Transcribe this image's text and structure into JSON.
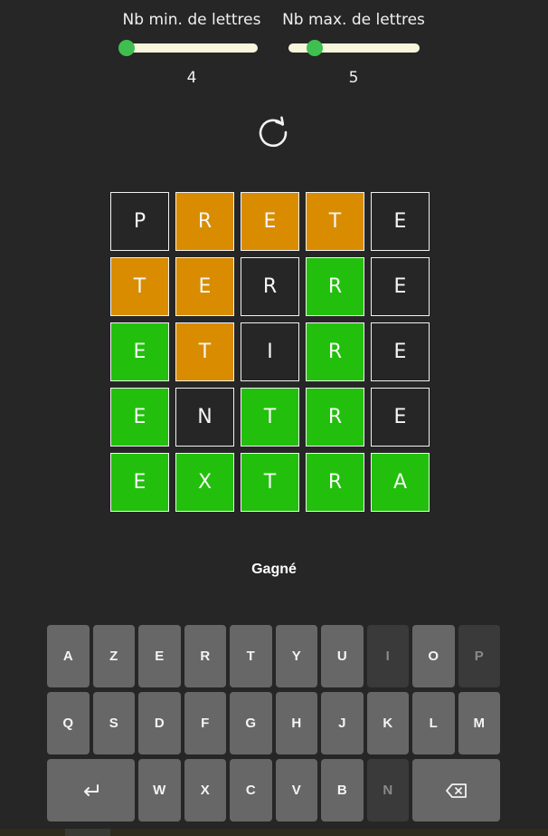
{
  "sliders": {
    "min": {
      "label": "Nb min. de lettres",
      "value": "4",
      "fraction": 0.0
    },
    "max": {
      "label": "Nb max. de lettres",
      "value": "5",
      "fraction": 0.2
    }
  },
  "colors": {
    "absent": "#262626",
    "present": "#d98c00",
    "correct": "#22c00c",
    "slider_thumb": "#3fbf4f",
    "slider_track": "#f7f5dc"
  },
  "reset_icon": "refresh-icon",
  "grid": [
    [
      {
        "letter": "P",
        "state": "absent"
      },
      {
        "letter": "R",
        "state": "present"
      },
      {
        "letter": "E",
        "state": "present"
      },
      {
        "letter": "T",
        "state": "present"
      },
      {
        "letter": "E",
        "state": "absent"
      }
    ],
    [
      {
        "letter": "T",
        "state": "present"
      },
      {
        "letter": "E",
        "state": "present"
      },
      {
        "letter": "R",
        "state": "absent"
      },
      {
        "letter": "R",
        "state": "correct"
      },
      {
        "letter": "E",
        "state": "absent"
      }
    ],
    [
      {
        "letter": "E",
        "state": "correct"
      },
      {
        "letter": "T",
        "state": "present"
      },
      {
        "letter": "I",
        "state": "absent"
      },
      {
        "letter": "R",
        "state": "correct"
      },
      {
        "letter": "E",
        "state": "absent"
      }
    ],
    [
      {
        "letter": "E",
        "state": "correct"
      },
      {
        "letter": "N",
        "state": "absent"
      },
      {
        "letter": "T",
        "state": "correct"
      },
      {
        "letter": "R",
        "state": "correct"
      },
      {
        "letter": "E",
        "state": "absent"
      }
    ],
    [
      {
        "letter": "E",
        "state": "correct"
      },
      {
        "letter": "X",
        "state": "correct"
      },
      {
        "letter": "T",
        "state": "correct"
      },
      {
        "letter": "R",
        "state": "correct"
      },
      {
        "letter": "A",
        "state": "correct"
      }
    ]
  ],
  "status": "Gagné",
  "keyboard": [
    [
      {
        "label": "A",
        "used": false
      },
      {
        "label": "Z",
        "used": false
      },
      {
        "label": "E",
        "used": false
      },
      {
        "label": "R",
        "used": false
      },
      {
        "label": "T",
        "used": false
      },
      {
        "label": "Y",
        "used": false
      },
      {
        "label": "U",
        "used": false
      },
      {
        "label": "I",
        "used": true
      },
      {
        "label": "O",
        "used": false
      },
      {
        "label": "P",
        "used": true
      }
    ],
    [
      {
        "label": "Q",
        "used": false
      },
      {
        "label": "S",
        "used": false
      },
      {
        "label": "D",
        "used": false
      },
      {
        "label": "F",
        "used": false
      },
      {
        "label": "G",
        "used": false
      },
      {
        "label": "H",
        "used": false
      },
      {
        "label": "J",
        "used": false
      },
      {
        "label": "K",
        "used": false
      },
      {
        "label": "L",
        "used": false
      },
      {
        "label": "M",
        "used": false
      }
    ],
    [
      {
        "label": "↵",
        "icon": "enter-icon",
        "used": false
      },
      {
        "label": "W",
        "used": false
      },
      {
        "label": "X",
        "used": false
      },
      {
        "label": "C",
        "used": false
      },
      {
        "label": "V",
        "used": false
      },
      {
        "label": "B",
        "used": false
      },
      {
        "label": "N",
        "used": true
      },
      {
        "label": "",
        "icon": "backspace-icon",
        "used": false
      }
    ]
  ]
}
